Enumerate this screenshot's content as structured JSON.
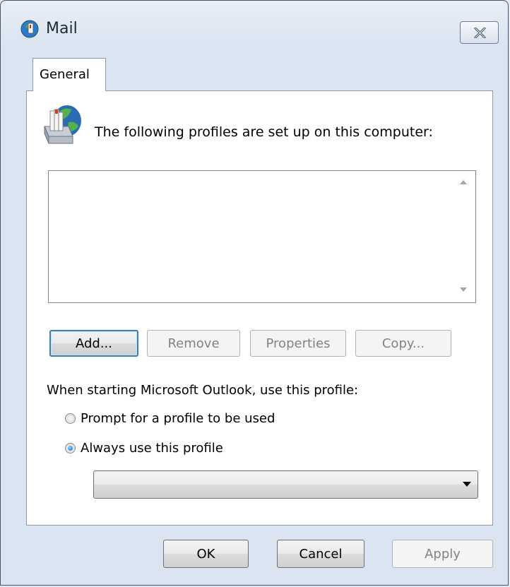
{
  "window": {
    "title": "Mail",
    "close_icon": "close-icon"
  },
  "tabs": [
    {
      "label": "General",
      "selected": true
    }
  ],
  "general": {
    "heading": "The following profiles are set up on this computer:",
    "profiles": [],
    "buttons": {
      "add": "Add...",
      "remove": "Remove",
      "properties": "Properties",
      "copy": "Copy..."
    },
    "startup_label": "When starting Microsoft Outlook, use this profile:",
    "radio_prompt": "Prompt for a profile to be used",
    "radio_always": "Always use this profile",
    "selected_option": "Always use this profile",
    "profile_select_value": ""
  },
  "footer": {
    "ok": "OK",
    "cancel": "Cancel",
    "apply": "Apply"
  },
  "colors": {
    "window_border": "#3e5573",
    "default_button_border": "#3c7fb1",
    "disabled_text": "#838383"
  }
}
